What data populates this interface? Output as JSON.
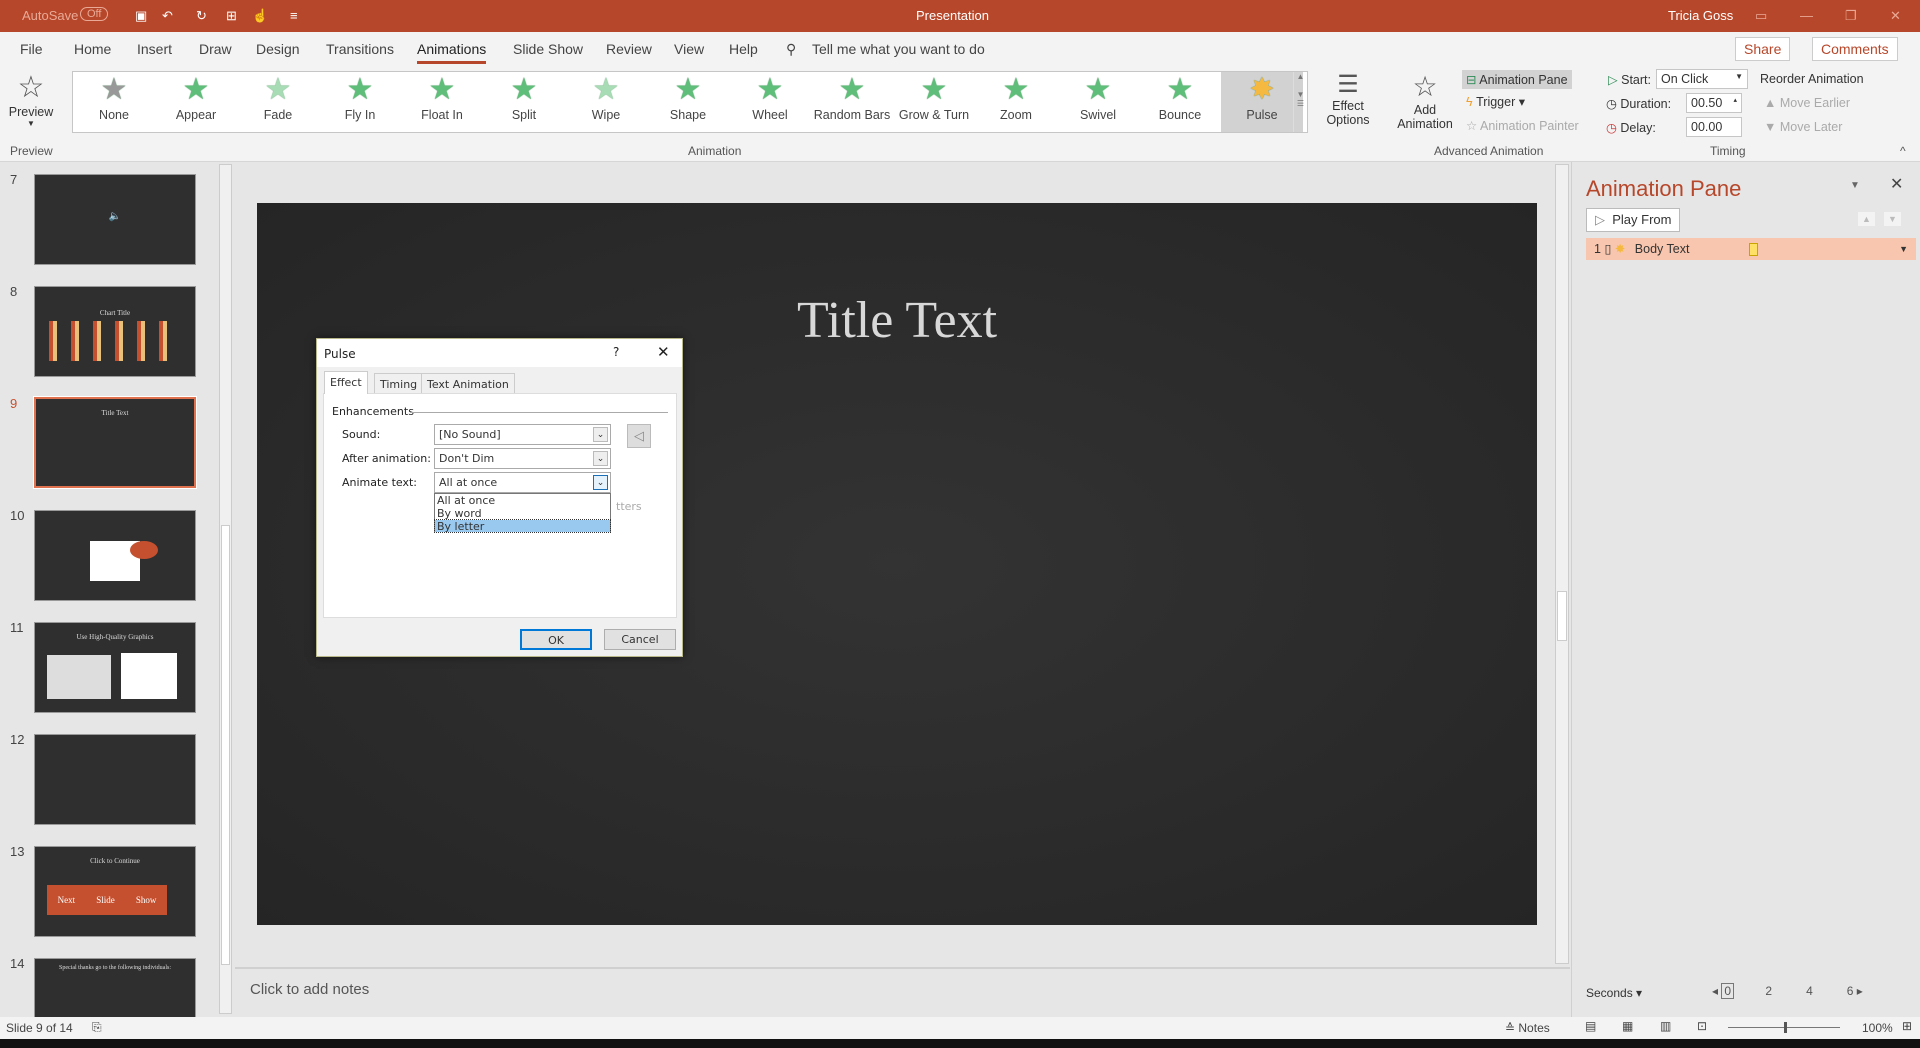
{
  "titlebar": {
    "autosave": "AutoSave",
    "autosave_state": "Off",
    "title": "Presentation",
    "user": "Tricia Goss"
  },
  "menu": {
    "items": [
      "File",
      "Home",
      "Insert",
      "Draw",
      "Design",
      "Transitions",
      "Animations",
      "Slide Show",
      "Review",
      "View",
      "Help"
    ],
    "active": "Animations",
    "tell_me": "Tell me what you want to do",
    "share": "Share",
    "comments": "Comments"
  },
  "ribbon": {
    "preview_label": "Preview",
    "preview_group": "Preview",
    "animations": [
      "None",
      "Appear",
      "Fade",
      "Fly In",
      "Float In",
      "Split",
      "Wipe",
      "Shape",
      "Wheel",
      "Random Bars",
      "Grow & Turn",
      "Zoom",
      "Swivel",
      "Bounce",
      "Pulse"
    ],
    "selected_animation": "Pulse",
    "effect_options": "Effect Options",
    "animation_group": "Animation",
    "add_animation": "Add Animation",
    "animation_pane": "Animation Pane",
    "trigger": "Trigger",
    "animation_painter": "Animation Painter",
    "advanced_group": "Advanced Animation",
    "start_label": "Start:",
    "start_value": "On Click",
    "duration_label": "Duration:",
    "duration_value": "00.50",
    "delay_label": "Delay:",
    "delay_value": "00.00",
    "reorder": "Reorder Animation",
    "move_earlier": "Move Earlier",
    "move_later": "Move Later",
    "timing_group": "Timing"
  },
  "thumbnails": [
    {
      "num": "7",
      "text": "🔈"
    },
    {
      "num": "8",
      "text": "Chart Title"
    },
    {
      "num": "9",
      "text": "Title Text",
      "selected": true
    },
    {
      "num": "10",
      "text": ""
    },
    {
      "num": "11",
      "text": "Use High-Quality Graphics"
    },
    {
      "num": "12",
      "text": ""
    },
    {
      "num": "13",
      "text": "Click to Continue",
      "arrow": [
        "Next",
        "Slide",
        "Show"
      ]
    },
    {
      "num": "14",
      "text": "Special thanks go to the following individuals:"
    }
  ],
  "slide": {
    "title": "Title Text"
  },
  "notes": {
    "placeholder": "Click to add notes"
  },
  "pane": {
    "title": "Animation Pane",
    "play_from": "Play From",
    "item_num": "1",
    "item_label": "Body Text",
    "timeline_unit": "Seconds",
    "ticks": [
      "0",
      "2",
      "4",
      "6"
    ]
  },
  "status": {
    "slide": "Slide 9 of 14",
    "notes": "Notes",
    "zoom": "100%"
  },
  "dialog": {
    "title": "Pulse",
    "help": "?",
    "tabs": [
      "Effect",
      "Timing",
      "Text Animation"
    ],
    "active_tab": "Effect",
    "section": "Enhancements",
    "sound_label": "Sound:",
    "sound_value": "[No Sound]",
    "after_label": "After animation:",
    "after_value": "Don't Dim",
    "animate_label": "Animate text:",
    "animate_value": "All at once",
    "options": [
      "All at once",
      "By word",
      "By letter"
    ],
    "highlighted_option": "By letter",
    "behind_text": "tters",
    "ok": "OK",
    "cancel": "Cancel"
  },
  "colors": {
    "accent": "#b7472a",
    "selected_item": "#f8c6ae",
    "star": "#5fbf7a"
  }
}
